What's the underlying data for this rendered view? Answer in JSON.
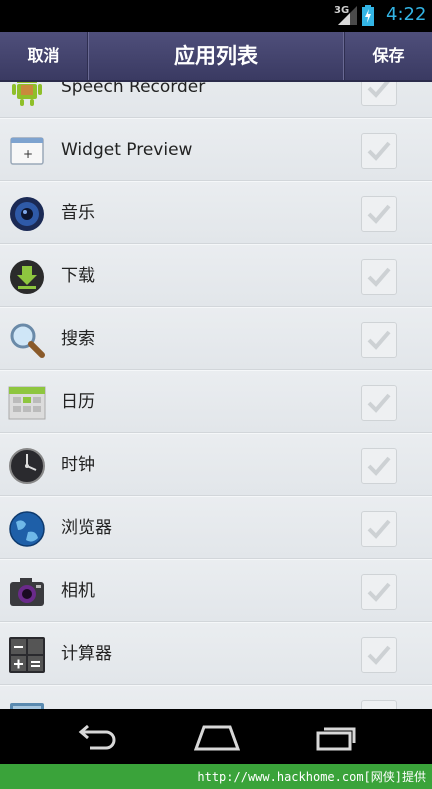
{
  "status_bar": {
    "network": "3G",
    "time": "4:22"
  },
  "action_bar": {
    "cancel_label": "取消",
    "title": "应用列表",
    "save_label": "保存"
  },
  "apps": [
    {
      "label": "Speech Recorder",
      "icon": "android-robot-icon",
      "checked": true
    },
    {
      "label": "Widget Preview",
      "icon": "widget-preview-icon",
      "checked": true
    },
    {
      "label": "音乐",
      "icon": "music-speaker-icon",
      "checked": true
    },
    {
      "label": "下载",
      "icon": "download-icon",
      "checked": true
    },
    {
      "label": "搜索",
      "icon": "magnifier-icon",
      "checked": true
    },
    {
      "label": "日历",
      "icon": "calendar-icon",
      "checked": true
    },
    {
      "label": "时钟",
      "icon": "clock-icon",
      "checked": true
    },
    {
      "label": "浏览器",
      "icon": "globe-icon",
      "checked": true
    },
    {
      "label": "相机",
      "icon": "camera-icon",
      "checked": true
    },
    {
      "label": "计算器",
      "icon": "calculator-icon",
      "checked": true
    },
    {
      "label": "",
      "icon": "gallery-icon",
      "checked": true
    }
  ],
  "nav_bar": {
    "back": "back-icon",
    "home": "home-icon",
    "recent": "recent-apps-icon"
  },
  "footer": {
    "credit": "http://www.hackhome.com[网侠]提供"
  },
  "colors": {
    "action_bar": "#45456f",
    "status_time": "#33b5e5",
    "footer": "#3aa33a"
  }
}
